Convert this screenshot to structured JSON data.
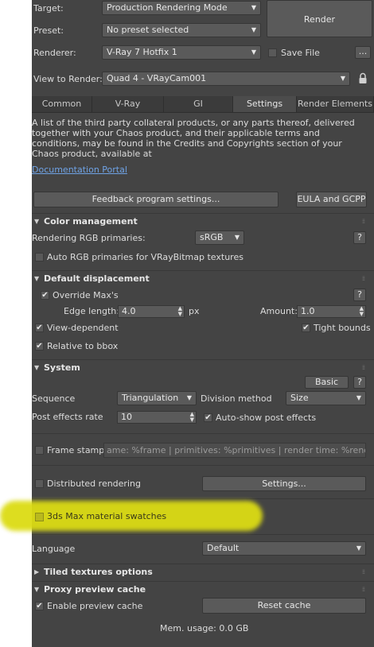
{
  "header": {
    "target_label": "Target:",
    "target_value": "Production Rendering Mode",
    "preset_label": "Preset:",
    "preset_value": "No preset selected",
    "renderer_label": "Renderer:",
    "renderer_value": "V-Ray 7 Hotfix 1",
    "save_file_label": "Save File",
    "save_file_checked": false,
    "ellipsis_label": "...",
    "view_label": "View to Render:",
    "view_value": "Quad 4 - VRayCam001",
    "render_button": "Render"
  },
  "tabs": [
    "Common",
    "V-Ray",
    "GI",
    "Settings",
    "Render Elements"
  ],
  "active_tab": "Settings",
  "notice": {
    "text": "A list of the third party collateral products, or any parts thereof, delivered together with your Chaos product, and their applicable terms and conditions, may be found in the Credits and Copyrights section of your Chaos product, available at",
    "link": "Documentation Portal",
    "feedback_button": "Feedback program settings...",
    "eula_button": "EULA and GCPP"
  },
  "color_management": {
    "title": "Color management",
    "primaries_label": "Rendering RGB primaries:",
    "primaries_value": "sRGB",
    "help": "?",
    "auto_label": "Auto RGB primaries for VRayBitmap textures",
    "auto_checked": false
  },
  "displacement": {
    "title": "Default displacement",
    "override_label": "Override Max's",
    "override_checked": true,
    "help": "?",
    "edge_label": "Edge length:",
    "edge_value": "4.0",
    "px_label": "px",
    "amount_label": "Amount:",
    "amount_value": "1.0",
    "view_dep_label": "View-dependent",
    "view_dep_checked": true,
    "tight_label": "Tight bounds",
    "tight_checked": true,
    "relative_label": "Relative to bbox",
    "relative_checked": true
  },
  "system": {
    "title": "System",
    "basic_button": "Basic",
    "help": "?",
    "sequence_label": "Sequence",
    "sequence_value": "Triangulation",
    "division_label": "Division method",
    "division_value": "Size",
    "post_label": "Post effects rate",
    "post_value": "10",
    "autoshow_label": "Auto-show post effects",
    "autoshow_checked": true,
    "frame_stamp_label": "Frame stamp",
    "frame_stamp_checked": false,
    "frame_stamp_value": "ame: %frame | primitives: %primitives | render time: %rendertime",
    "distributed_label": "Distributed rendering",
    "distributed_checked": false,
    "settings_button": "Settings...",
    "swatches_label": "3ds Max material swatches",
    "swatches_checked": false,
    "language_label": "Language",
    "language_value": "Default"
  },
  "tiled": {
    "title": "Tiled textures options"
  },
  "proxy": {
    "title": "Proxy preview cache",
    "enable_label": "Enable preview cache",
    "enable_checked": true,
    "reset_button": "Reset cache",
    "mem_usage": "Mem. usage: 0.0 GB"
  }
}
